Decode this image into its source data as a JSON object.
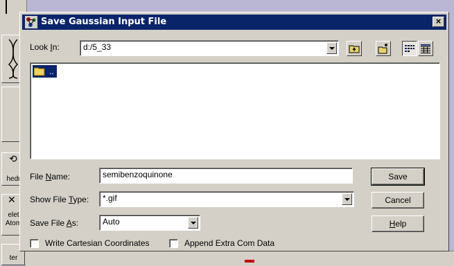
{
  "background": {
    "tool_labels": [
      "hedr",
      "elet",
      "Atom",
      "ter"
    ]
  },
  "dialog": {
    "title": "Save Gaussian Input File",
    "close_glyph": "×",
    "look_in": {
      "label_pre": "Look ",
      "label_key": "I",
      "label_post": "n:",
      "value": "d:/5_33"
    },
    "toolbar_icons": [
      "up-one-level-icon",
      "create-new-folder-icon",
      "list-view-icon",
      "details-view-icon"
    ],
    "file_list": {
      "items": [
        {
          "name": "..",
          "icon": "folder-icon",
          "selected": true
        }
      ]
    },
    "file_name": {
      "label_pre": "File ",
      "label_key": "N",
      "label_post": "ame:",
      "value": "semibenzoquinone"
    },
    "show_file_type": {
      "label_pre": "Show File ",
      "label_key": "T",
      "label_post": "ype:",
      "value": "*.gif"
    },
    "save_file_as": {
      "label_pre": "Save File ",
      "label_key": "A",
      "label_post": "s:",
      "value": "Auto"
    },
    "checkboxes": {
      "write_cartesian": {
        "label": "Write Cartesian Coordinates",
        "checked": false
      },
      "append_extra": {
        "label": "Append Extra Com Data",
        "checked": false
      }
    },
    "buttons": {
      "save": "Save",
      "cancel": "Cancel",
      "help_key": "H",
      "help_rest": "elp"
    }
  },
  "colors": {
    "title_bar": "#0a246a",
    "face": "#d4d0c8",
    "selection": "#0a246a",
    "desktop": "#b9b7d3"
  }
}
